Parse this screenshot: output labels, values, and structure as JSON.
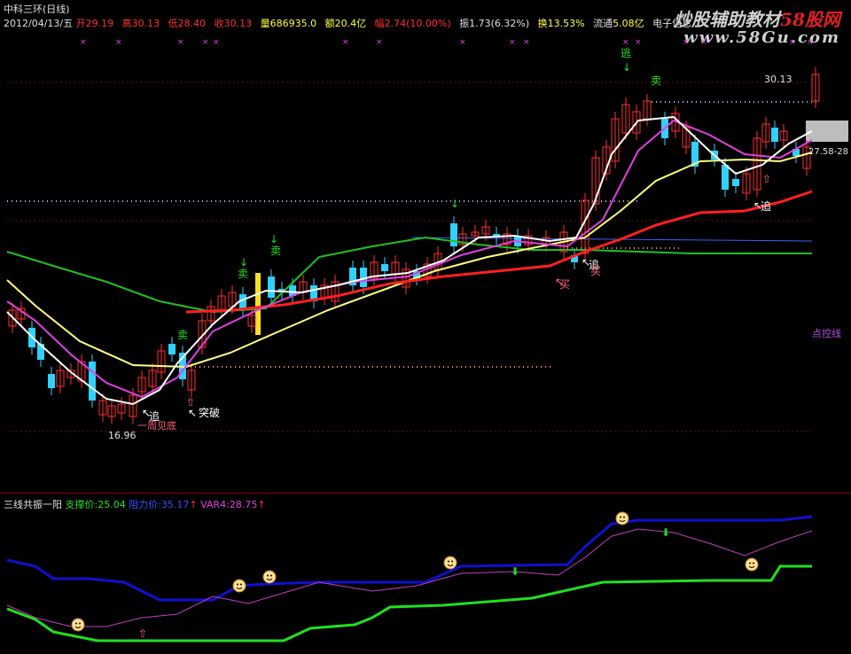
{
  "header": {
    "stock_title": "中科三环(日线)",
    "date": "2012/04/13/五",
    "open_label": "开",
    "open": "29.19",
    "high_label": "高",
    "high": "30.13",
    "low_label": "低",
    "low": "28.40",
    "close_label": "收",
    "close": "30.13",
    "volume_label": "量",
    "volume": "686935.0",
    "amount_label": "额",
    "amount": "20.4亿",
    "change_label": "幅",
    "change": "2.74(10.00%)",
    "amplitude_label": "振",
    "amplitude": "1.73(6.32%)",
    "turnover_label": "换",
    "turnover": "13.53%",
    "float_label": "流通",
    "float": "5.08亿",
    "sector": "电子信息"
  },
  "watermark": {
    "brand": "炒股辅助教材",
    "brand_red": "58股网",
    "url": "www.58Gu.com"
  },
  "colors": {
    "up": "#ff3030",
    "down": "#30d0ff",
    "white_ma": "#ffffff",
    "magenta_ma": "#e040e0",
    "yellow_ma": "#ffff80",
    "red_ma": "#ff2020",
    "green_ma": "#20c020",
    "blue_line": "#1010d0",
    "pink_line": "#c040c0",
    "green_line": "#20e020"
  },
  "annotations": {
    "price_high": "30.13",
    "price_low": "16.96",
    "price_side": "27.58-28",
    "level_label": "点控线",
    "chase1": "追",
    "chase2": "追",
    "chase3": "追",
    "bottom_label": "一周见底",
    "breakout": "突破",
    "buy1": "买",
    "buy2": "买",
    "sell1": "卖",
    "sell2": "卖",
    "sell3": "卖",
    "sell4": "卖",
    "escape": "逃"
  },
  "indicator": {
    "name": "三线共振一阳",
    "support_label": "支撑价:",
    "support_value": "25.04",
    "resist_label": "阻力价:",
    "resist_value": "35.17",
    "var4_label": "VAR4:",
    "var4_value": "28.75"
  },
  "icons": [
    "smiley-icon",
    "arrow-up-icon",
    "arrow-down-icon",
    "x-mark-icon"
  ]
}
